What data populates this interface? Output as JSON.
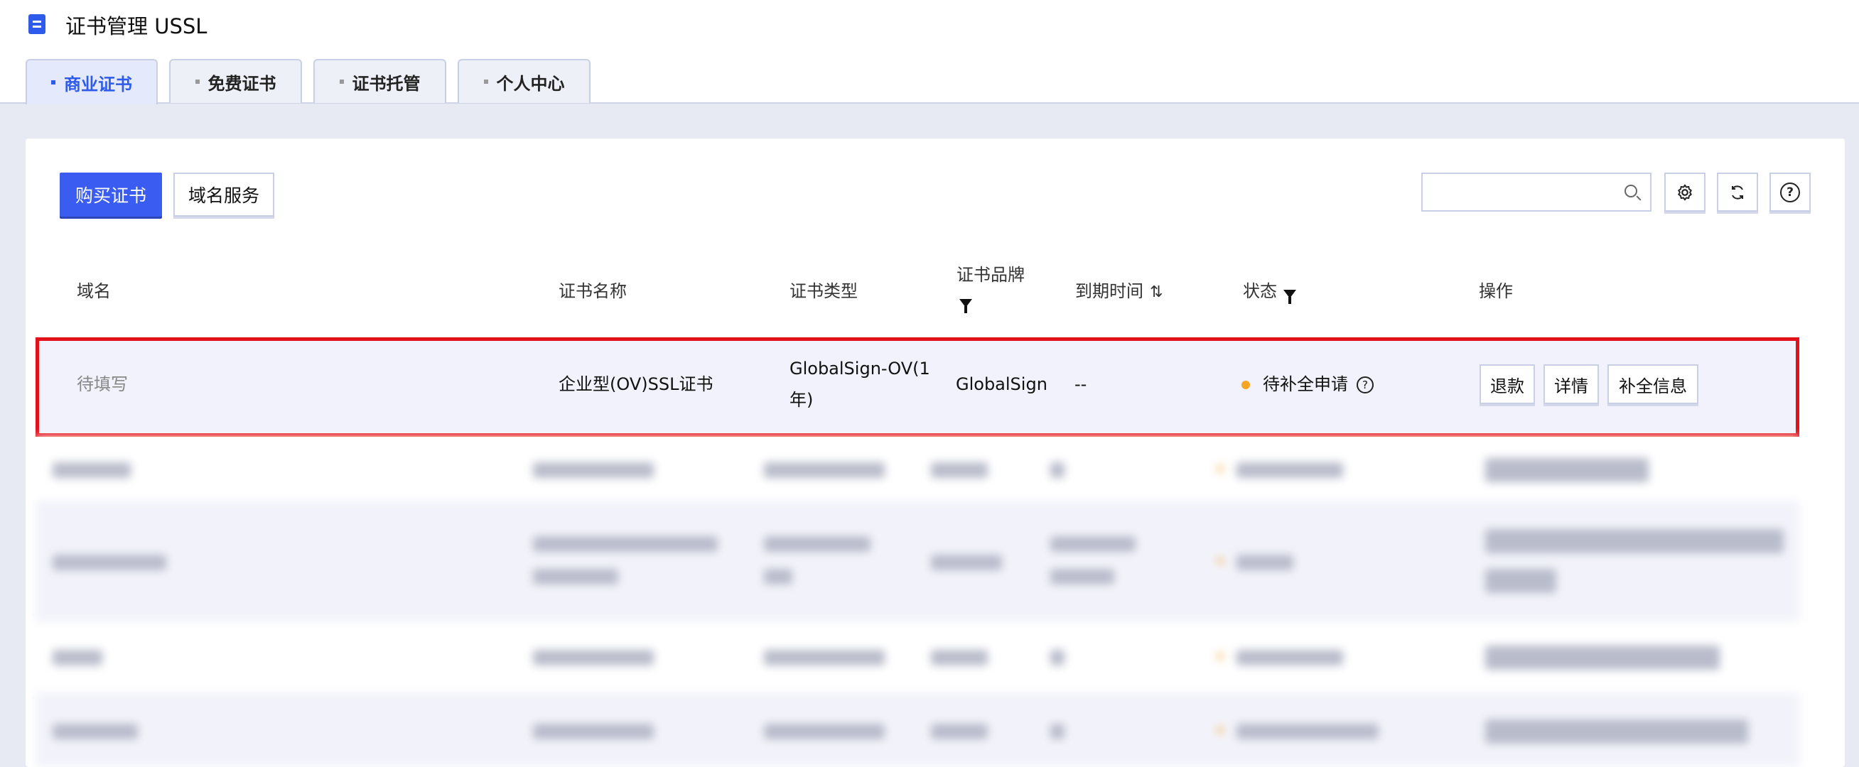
{
  "header": {
    "title": "证书管理 USSL",
    "tabs": [
      {
        "label": "商业证书",
        "active": true
      },
      {
        "label": "免费证书",
        "active": false
      },
      {
        "label": "证书托管",
        "active": false
      },
      {
        "label": "个人中心",
        "active": false
      }
    ]
  },
  "toolbar": {
    "buy_label": "购买证书",
    "domain_service_label": "域名服务",
    "search_placeholder": "",
    "settings_icon": "gear-icon",
    "refresh_icon": "refresh-icon",
    "help_icon": "help-icon"
  },
  "table": {
    "columns": [
      "域名",
      "证书名称",
      "证书类型",
      "证书品牌",
      "到期时间",
      "状态",
      "操作"
    ],
    "highlighted_row": {
      "domain": "待填写",
      "cert_name": "企业型(OV)SSL证书",
      "cert_type_line1": "GlobalSign-OV(1",
      "cert_type_line2": "年)",
      "brand": "GlobalSign",
      "expiry": "--",
      "status": "待补全申请",
      "actions": [
        "退款",
        "详情",
        "补全信息"
      ]
    }
  },
  "colors": {
    "accent": "#3a5cf0",
    "highlight_border": "#e2121a",
    "status_pending": "#f5a623"
  }
}
